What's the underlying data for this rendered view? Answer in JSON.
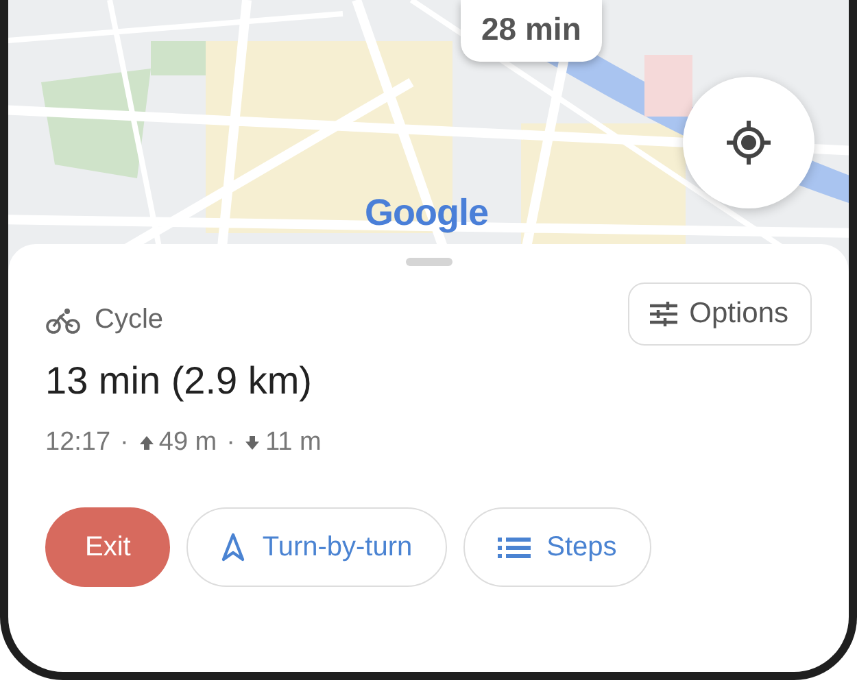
{
  "map": {
    "time_badge": "28 min",
    "logo": "Google"
  },
  "mode": {
    "label": "Cycle"
  },
  "options_button": "Options",
  "summary": "13 min (2.9 km)",
  "details": [
    {
      "kind": "time",
      "text": "12:17"
    },
    {
      "kind": "separator",
      "text": "·"
    },
    {
      "kind": "ascent",
      "text": "49 m"
    },
    {
      "kind": "separator",
      "text": "·"
    },
    {
      "kind": "descent",
      "text": "11 m"
    }
  ],
  "actions": [
    {
      "kind": "exit",
      "label": "Exit"
    },
    {
      "kind": "navigate",
      "label": "Turn-by-turn"
    },
    {
      "kind": "steps",
      "label": "Steps"
    }
  ]
}
